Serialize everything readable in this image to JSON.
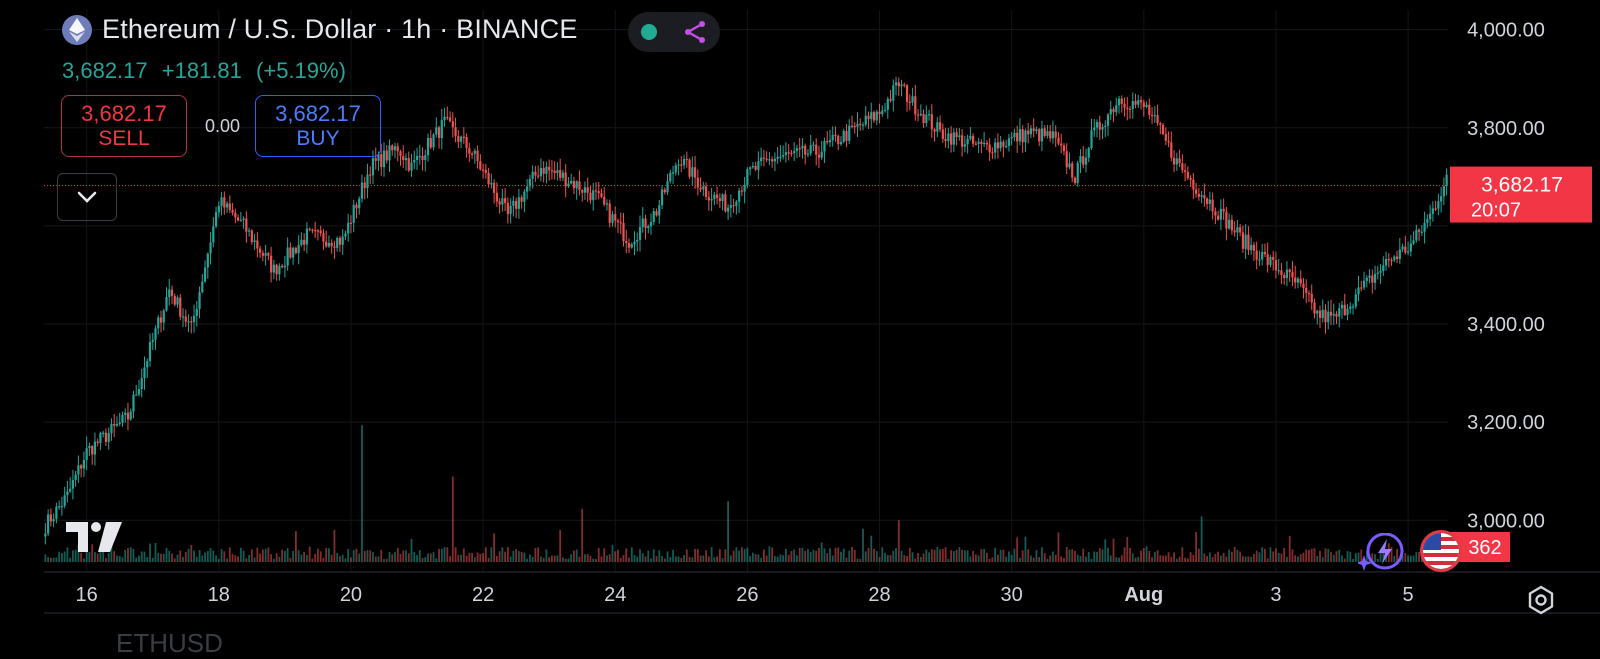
{
  "header": {
    "title": "Ethereum / U.S. Dollar · 1h · BINANCE",
    "last_price": "3,682.17",
    "change": "+181.81",
    "change_pct": "(+5.19%)"
  },
  "trade": {
    "sell_price": "3,682.17",
    "sell_label": "SELL",
    "spread": "0.00",
    "buy_price": "3,682.17",
    "buy_label": "BUY"
  },
  "price_badge": {
    "price": "3,682.17",
    "countdown": "20:07"
  },
  "volume_badge": "362",
  "bottom_symbol": "ETHUSD",
  "icons": [
    "ethereum-icon",
    "status-dot-icon",
    "share-icon",
    "chevron-down-icon",
    "tradingview-logo",
    "ai-spark-icon",
    "us-flag-icon",
    "settings-icon"
  ],
  "colors": {
    "up": "#26a69a",
    "down": "#ef5350",
    "background": "#000000",
    "price_line": "#f23645",
    "buy": "#2962ff"
  },
  "chart_data": {
    "type": "candlestick",
    "interval": "1h",
    "y_ticks": [
      "4,000.00",
      "3,800.00",
      "3,400.00",
      "3,200.00",
      "3,000.00"
    ],
    "y_ticks_values": [
      4000,
      3800,
      3400,
      3200,
      3000
    ],
    "ylim": [
      2915,
      4040
    ],
    "x_ticks": [
      "16",
      "18",
      "20",
      "22",
      "24",
      "26",
      "28",
      "30",
      "Aug",
      "3",
      "5"
    ],
    "x_ticks_index": [
      15,
      63,
      111,
      159,
      207,
      255,
      303,
      351,
      399,
      447,
      495
    ],
    "anchors": [
      [
        0,
        2990
      ],
      [
        8,
        3050
      ],
      [
        15,
        3140
      ],
      [
        30,
        3210
      ],
      [
        45,
        3470
      ],
      [
        53,
        3390
      ],
      [
        63,
        3650
      ],
      [
        72,
        3600
      ],
      [
        83,
        3510
      ],
      [
        95,
        3580
      ],
      [
        108,
        3570
      ],
      [
        118,
        3720
      ],
      [
        128,
        3760
      ],
      [
        133,
        3720
      ],
      [
        145,
        3810
      ],
      [
        155,
        3750
      ],
      [
        168,
        3620
      ],
      [
        180,
        3720
      ],
      [
        188,
        3700
      ],
      [
        200,
        3660
      ],
      [
        212,
        3570
      ],
      [
        222,
        3630
      ],
      [
        230,
        3740
      ],
      [
        240,
        3670
      ],
      [
        248,
        3640
      ],
      [
        256,
        3710
      ],
      [
        265,
        3740
      ],
      [
        280,
        3750
      ],
      [
        292,
        3790
      ],
      [
        303,
        3830
      ],
      [
        310,
        3890
      ],
      [
        315,
        3850
      ],
      [
        325,
        3790
      ],
      [
        340,
        3760
      ],
      [
        348,
        3770
      ],
      [
        357,
        3790
      ],
      [
        366,
        3780
      ],
      [
        374,
        3700
      ],
      [
        380,
        3780
      ],
      [
        390,
        3860
      ],
      [
        400,
        3840
      ],
      [
        411,
        3730
      ],
      [
        418,
        3680
      ],
      [
        426,
        3630
      ],
      [
        435,
        3570
      ],
      [
        446,
        3520
      ],
      [
        455,
        3480
      ],
      [
        462,
        3420
      ],
      [
        468,
        3410
      ],
      [
        478,
        3470
      ],
      [
        488,
        3530
      ],
      [
        496,
        3560
      ],
      [
        503,
        3620
      ],
      [
        509,
        3700
      ]
    ],
    "volume_spikes": [
      [
        115,
        0.72
      ],
      [
        148,
        0.45
      ],
      [
        195,
        0.28
      ],
      [
        248,
        0.32
      ],
      [
        310,
        0.22
      ],
      [
        420,
        0.24
      ]
    ]
  }
}
